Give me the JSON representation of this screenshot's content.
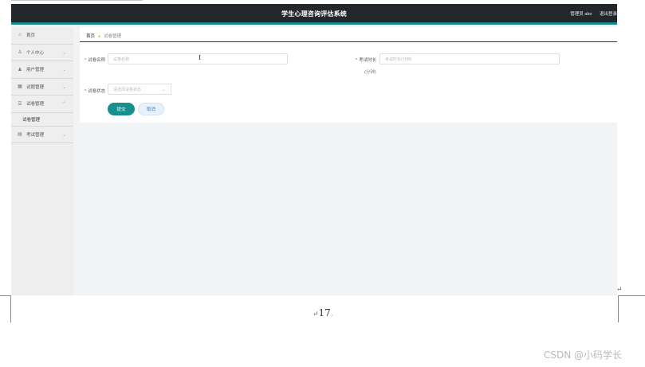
{
  "app": {
    "title": "学生心理咨询评估系统",
    "user_label": "管理员 abo",
    "logout_label": "退出登录",
    "accent_color": "#17898b",
    "header_color": "#23272b"
  },
  "sidebar": {
    "items": [
      {
        "label": "首页",
        "icon": "home-icon",
        "glyph": "⌂"
      },
      {
        "label": "个人中心",
        "icon": "person-icon",
        "glyph": "♙",
        "chevron": "⌄"
      },
      {
        "label": "用户管理",
        "icon": "users-icon",
        "glyph": "♟",
        "chevron": "⌄"
      },
      {
        "label": "试题管理",
        "icon": "grid-icon",
        "glyph": "▦",
        "chevron": "⌄"
      },
      {
        "label": "试卷管理",
        "icon": "list-icon",
        "glyph": "☰",
        "chevron": "⌃",
        "expanded": true,
        "sub": "试卷管理"
      },
      {
        "label": "考试管理",
        "icon": "exam-icon",
        "glyph": "▤",
        "chevron": "⌄"
      }
    ]
  },
  "breadcrumb": {
    "home": "首页",
    "separator": "●",
    "current": "试卷管理"
  },
  "form": {
    "name_label": "试卷名称",
    "name_placeholder": "试卷名称",
    "duration_label": "考试时长",
    "duration_unit": "(分钟)",
    "duration_placeholder": "考试时长(分钟)",
    "status_label": "试卷状态",
    "status_placeholder": "请选择试卷状态",
    "required_mark": "*",
    "submit_label": "提交",
    "cancel_label": "取消"
  },
  "document": {
    "page_number": "17",
    "watermark": "CSDN @小码学长"
  }
}
